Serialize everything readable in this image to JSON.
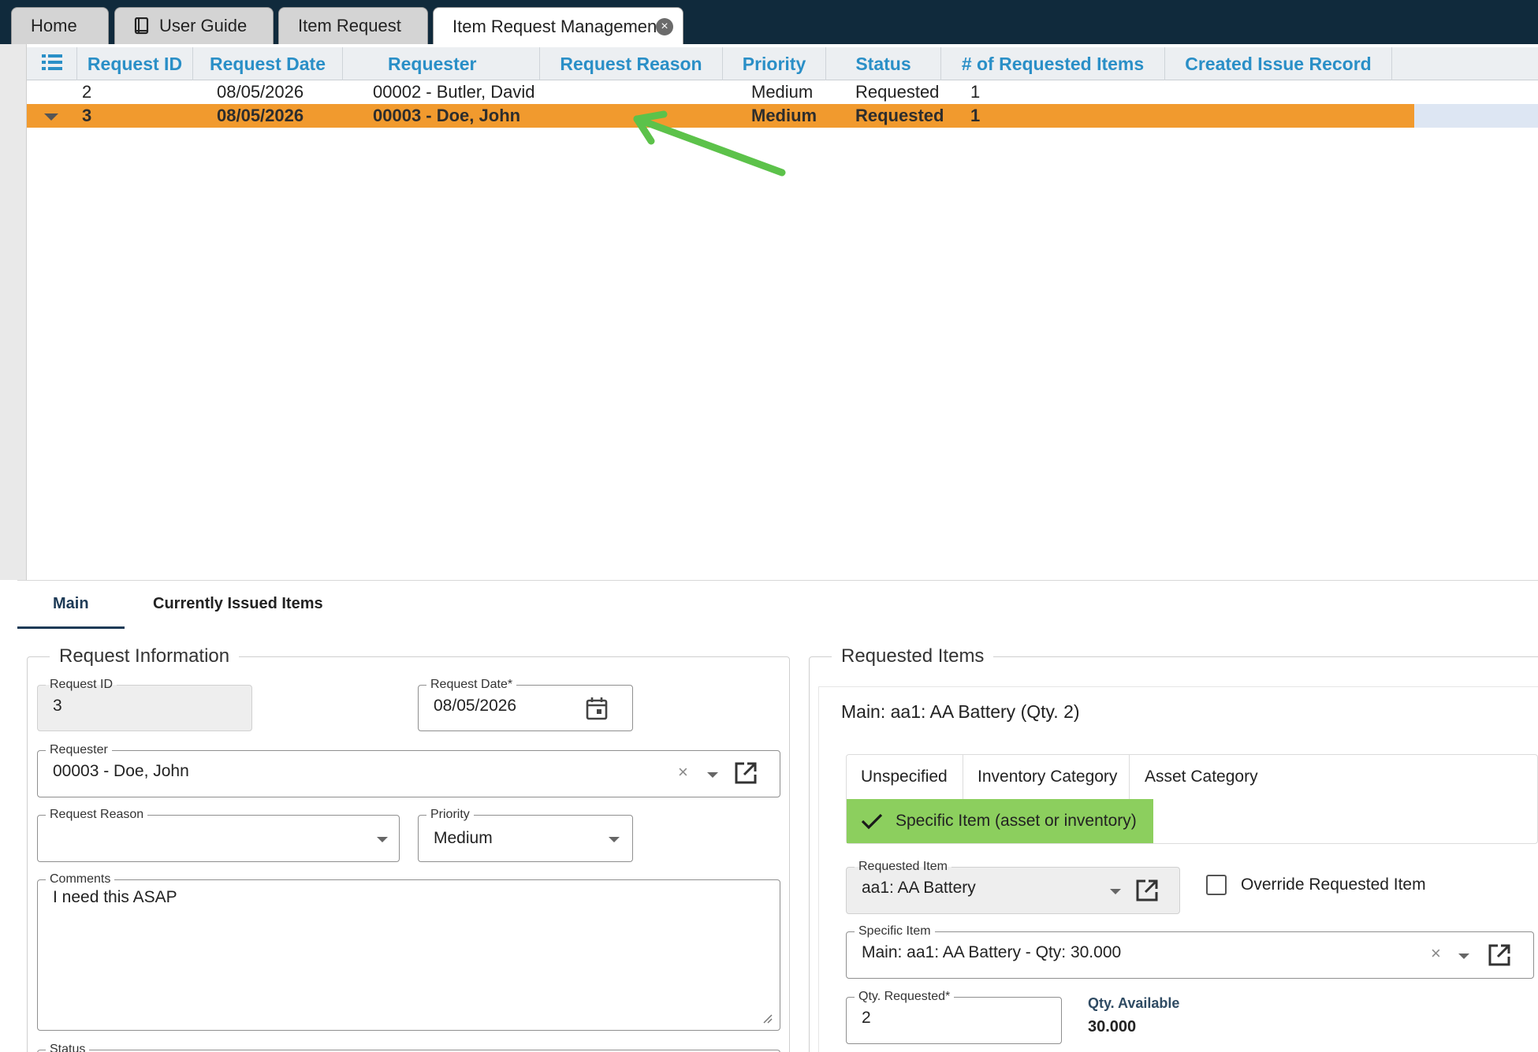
{
  "tabs": [
    {
      "label": "Home"
    },
    {
      "label": "User Guide"
    },
    {
      "label": "Item Request"
    },
    {
      "label": "Item Request Management"
    }
  ],
  "grid": {
    "columns": [
      "Request ID",
      "Request Date",
      "Requester",
      "Request Reason",
      "Priority",
      "Status",
      "# of Requested Items",
      "Created Issue Record"
    ],
    "rows": [
      {
        "id": "2",
        "date": "08/05/2026",
        "requester": "00002 - Butler, David",
        "reason": "",
        "priority": "Medium",
        "status": "Requested",
        "count": "1",
        "issue": ""
      },
      {
        "id": "3",
        "date": "08/05/2026",
        "requester": "00003 - Doe, John",
        "reason": "",
        "priority": "Medium",
        "status": "Requested",
        "count": "1",
        "issue": ""
      }
    ]
  },
  "subtabs": {
    "main": "Main",
    "issued": "Currently Issued Items"
  },
  "request_info": {
    "legend": "Request Information",
    "request_id_label": "Request ID",
    "request_id": "3",
    "request_date_label": "Request Date*",
    "request_date": "08/05/2026",
    "requester_label": "Requester",
    "requester": "00003 - Doe, John",
    "reason_label": "Request Reason",
    "reason": "",
    "priority_label": "Priority",
    "priority": "Medium",
    "comments_label": "Comments",
    "comments": "I need this ASAP",
    "status_label": "Status"
  },
  "requested_items": {
    "legend": "Requested Items",
    "item_title": "Main: aa1: AA Battery (Qty. 2)",
    "categories": [
      "Unspecified",
      "Inventory Category",
      "Asset Category"
    ],
    "selected_category": "Specific Item (asset or inventory)",
    "requested_item_label": "Requested Item",
    "requested_item": "aa1: AA Battery",
    "override_label": "Override Requested Item",
    "specific_item_label": "Specific Item",
    "specific_item": "Main: aa1: AA Battery - Qty: 30.000",
    "qty_requested_label": "Qty. Requested*",
    "qty_requested": "2",
    "qty_available_label": "Qty. Available",
    "qty_available": "30.000"
  },
  "colors": {
    "selected_row": "#f19a2e",
    "header_text": "#2a8fc7",
    "specific_selected": "#8ccf5e",
    "annotation_arrow": "#5cc24a"
  }
}
